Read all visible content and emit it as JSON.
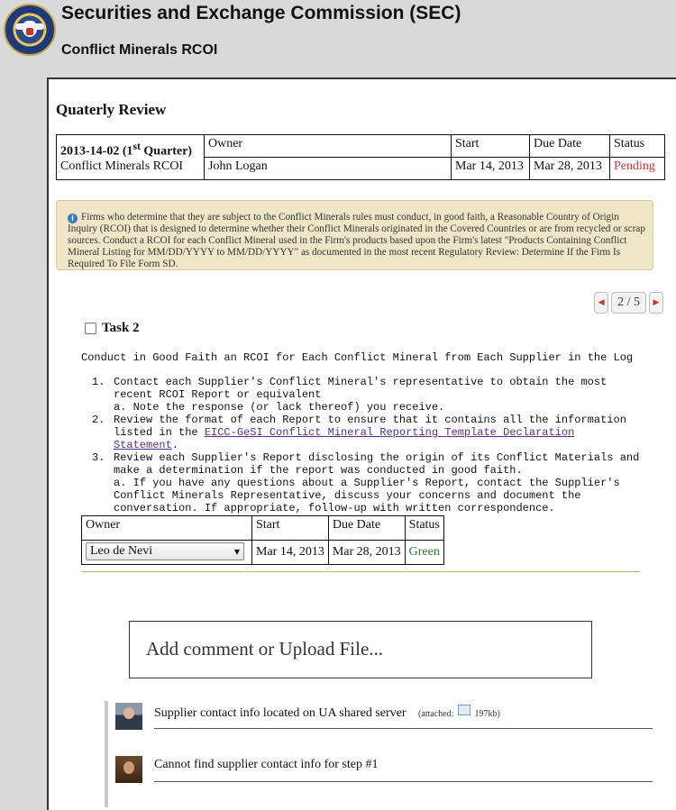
{
  "header": {
    "org_title": "Securities and Exchange Commission (SEC)",
    "subtitle": "Conflict Minerals RCOI"
  },
  "review": {
    "title": "Quaterly Review",
    "period_prefix": "2013-14-02 (1",
    "period_sup": "st",
    "period_suffix": " Quarter)",
    "name": "Conflict Minerals RCOI",
    "headers": {
      "owner": "Owner",
      "start": "Start",
      "due": "Due Date",
      "status": "Status"
    },
    "owner": "John Logan",
    "start": "Mar 14, 2013",
    "due": "Mar 28, 2013",
    "status": "Pending"
  },
  "notice": {
    "text": "Firms who determine that they are subject to the Conflict Minerals rules must conduct, in good faith, a Reasonable Country of Origin Inquiry (RCOI) that is designed to determine whether their Conflict Minerals originated in the Covered Countries or are from recycled or scrap sources. Conduct a RCOI for each Conflict Mineral used in the Firm's products based upon the Firm's latest \"Products Containing Conflict Mineral Listing for MM/DD/YYYY to MM/DD/YYYY\" as documented in the most recent Regulatory Review: Determine If the Firm Is Required To File Form SD."
  },
  "pager": {
    "label": "2 / 5"
  },
  "task": {
    "title": "Task 2",
    "description": "Conduct in Good Faith an RCOI for Each Conflict Mineral from Each Supplier in the Log",
    "steps": [
      {
        "num": "1.",
        "text": "Contact each Supplier's Conflict Mineral's representative to obtain the most recent RCOI Report or equivalent",
        "note": "a. Note the response (or lack thereof) you receive."
      },
      {
        "num": "2.",
        "text_before": "Review the format of each Report to ensure that it contains all the information listed in the ",
        "link": "EICC-GeSI Conflict Mineral Reporting Template Declaration Statement",
        "text_after": "."
      },
      {
        "num": "3.",
        "text": "Review each Supplier's Report disclosing the origin of its Conflict Materials and make a determination if the report was conducted in good faith.",
        "note": "a. If you have any questions about a Supplier's Report, contact the Supplier's Conflict Minerals Representative, discuss your concerns and document the conversation. If appropriate, follow-up with written correspondence."
      }
    ],
    "table": {
      "headers": {
        "owner": "Owner",
        "start": "Start",
        "due": "Due Date",
        "status": "Status"
      },
      "owner": "Leo de Nevi",
      "start": "Mar 14, 2013",
      "due": "Mar 28, 2013",
      "status": "Green"
    }
  },
  "comment_box": {
    "placeholder": "Add comment or Upload File..."
  },
  "comments": [
    {
      "text": "Supplier contact info located on UA shared server",
      "attached_label": "(attached:",
      "attached_size": "197kb)"
    },
    {
      "text": "Cannot find supplier contact info for step #1"
    }
  ],
  "colors": {
    "pending": "#d32f2f",
    "green": "#2e7d32",
    "notice_bg": "#efe6c7"
  }
}
